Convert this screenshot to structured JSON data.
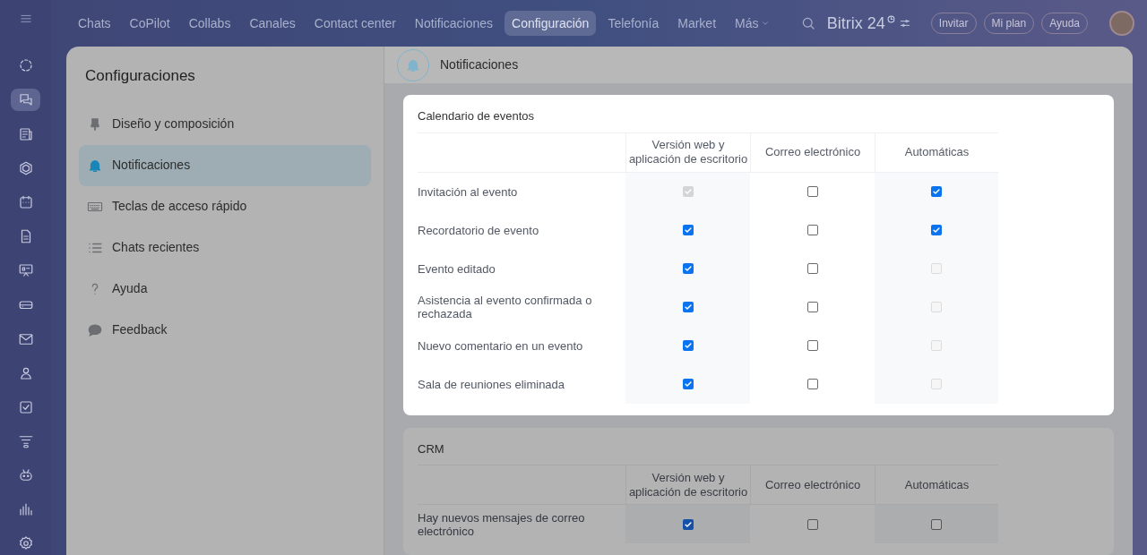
{
  "top_nav": {
    "items": [
      {
        "label": "Chats",
        "selected": false
      },
      {
        "label": "CoPilot",
        "selected": false
      },
      {
        "label": "Collabs",
        "selected": false
      },
      {
        "label": "Canales",
        "selected": false
      },
      {
        "label": "Contact center",
        "selected": false
      },
      {
        "label": "Notificaciones",
        "selected": false
      },
      {
        "label": "Configuración",
        "selected": true
      },
      {
        "label": "Telefonía",
        "selected": false
      },
      {
        "label": "Market",
        "selected": false
      },
      {
        "label": "Más",
        "selected": false
      }
    ],
    "logo": "Bitrix 24",
    "buttons": [
      "Invitar",
      "Mi plan",
      "Ayuda"
    ]
  },
  "settings_menu": {
    "title": "Configuraciones",
    "items": [
      {
        "label": "Diseño y composición",
        "kind": "brush",
        "selected": false
      },
      {
        "label": "Notificaciones",
        "kind": "bell",
        "selected": true
      },
      {
        "label": "Teclas de acceso rápido",
        "kind": "keyboard",
        "selected": false
      },
      {
        "label": "Chats recientes",
        "kind": "list",
        "selected": false
      },
      {
        "label": "Ayuda",
        "kind": "question",
        "selected": false
      },
      {
        "label": "Feedback",
        "kind": "bubble",
        "selected": false
      }
    ]
  },
  "content_header": {
    "title": "Notificaciones"
  },
  "sections": [
    {
      "title": "Calendario de eventos",
      "highlighted": true,
      "columns": [
        "Versión web y aplicación de escritorio",
        "Correo electrónico",
        "Automáticas"
      ],
      "rows": [
        {
          "label": "Invitación al evento",
          "cells": [
            {
              "checked": true,
              "disabled": true
            },
            {
              "checked": false,
              "disabled": false
            },
            {
              "checked": true,
              "disabled": false
            }
          ]
        },
        {
          "label": "Recordatorio de evento",
          "cells": [
            {
              "checked": true,
              "disabled": false
            },
            {
              "checked": false,
              "disabled": false
            },
            {
              "checked": true,
              "disabled": false
            }
          ]
        },
        {
          "label": "Evento editado",
          "cells": [
            {
              "checked": true,
              "disabled": false
            },
            {
              "checked": false,
              "disabled": false
            },
            {
              "checked": false,
              "disabled": true
            }
          ]
        },
        {
          "label": "Asistencia al evento confirmada o rechazada",
          "cells": [
            {
              "checked": true,
              "disabled": false
            },
            {
              "checked": false,
              "disabled": false
            },
            {
              "checked": false,
              "disabled": true
            }
          ]
        },
        {
          "label": "Nuevo comentario en un evento",
          "cells": [
            {
              "checked": true,
              "disabled": false
            },
            {
              "checked": false,
              "disabled": false
            },
            {
              "checked": false,
              "disabled": true
            }
          ]
        },
        {
          "label": "Sala de reuniones eliminada",
          "cells": [
            {
              "checked": true,
              "disabled": false
            },
            {
              "checked": false,
              "disabled": false
            },
            {
              "checked": false,
              "disabled": true
            }
          ]
        }
      ]
    },
    {
      "title": "CRM",
      "highlighted": false,
      "columns": [
        "Versión web y aplicación de escritorio",
        "Correo electrónico",
        "Automáticas"
      ],
      "rows": [
        {
          "label": "Hay nuevos mensajes de correo electrónico",
          "cells": [
            {
              "checked": true,
              "disabled": false
            },
            {
              "checked": false,
              "disabled": false
            },
            {
              "checked": false,
              "disabled": false
            }
          ]
        }
      ]
    }
  ]
}
